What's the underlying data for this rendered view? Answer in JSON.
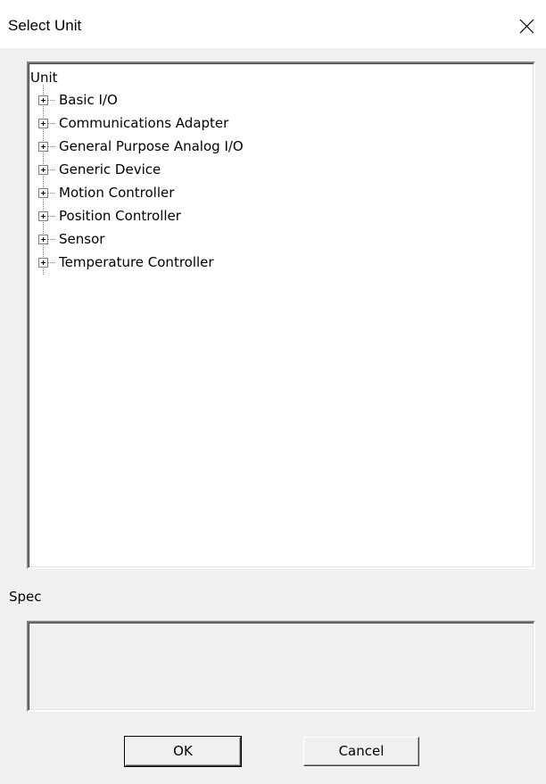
{
  "window": {
    "title": "Select Unit",
    "close_icon": "close-icon"
  },
  "tree": {
    "root_label": "Unit",
    "items": [
      {
        "label": "Basic I/O",
        "expand_icon": "plus-box-icon"
      },
      {
        "label": "Communications Adapter",
        "expand_icon": "plus-box-icon"
      },
      {
        "label": "General Purpose Analog I/O",
        "expand_icon": "plus-box-icon"
      },
      {
        "label": "Generic Device",
        "expand_icon": "plus-box-icon"
      },
      {
        "label": "Motion Controller",
        "expand_icon": "plus-box-icon"
      },
      {
        "label": "Position Controller",
        "expand_icon": "plus-box-icon"
      },
      {
        "label": "Sensor",
        "expand_icon": "plus-box-icon"
      },
      {
        "label": "Temperature Controller",
        "expand_icon": "plus-box-icon"
      }
    ]
  },
  "spec": {
    "label": "Spec",
    "value": ""
  },
  "buttons": {
    "ok_label": "OK",
    "cancel_label": "Cancel"
  }
}
